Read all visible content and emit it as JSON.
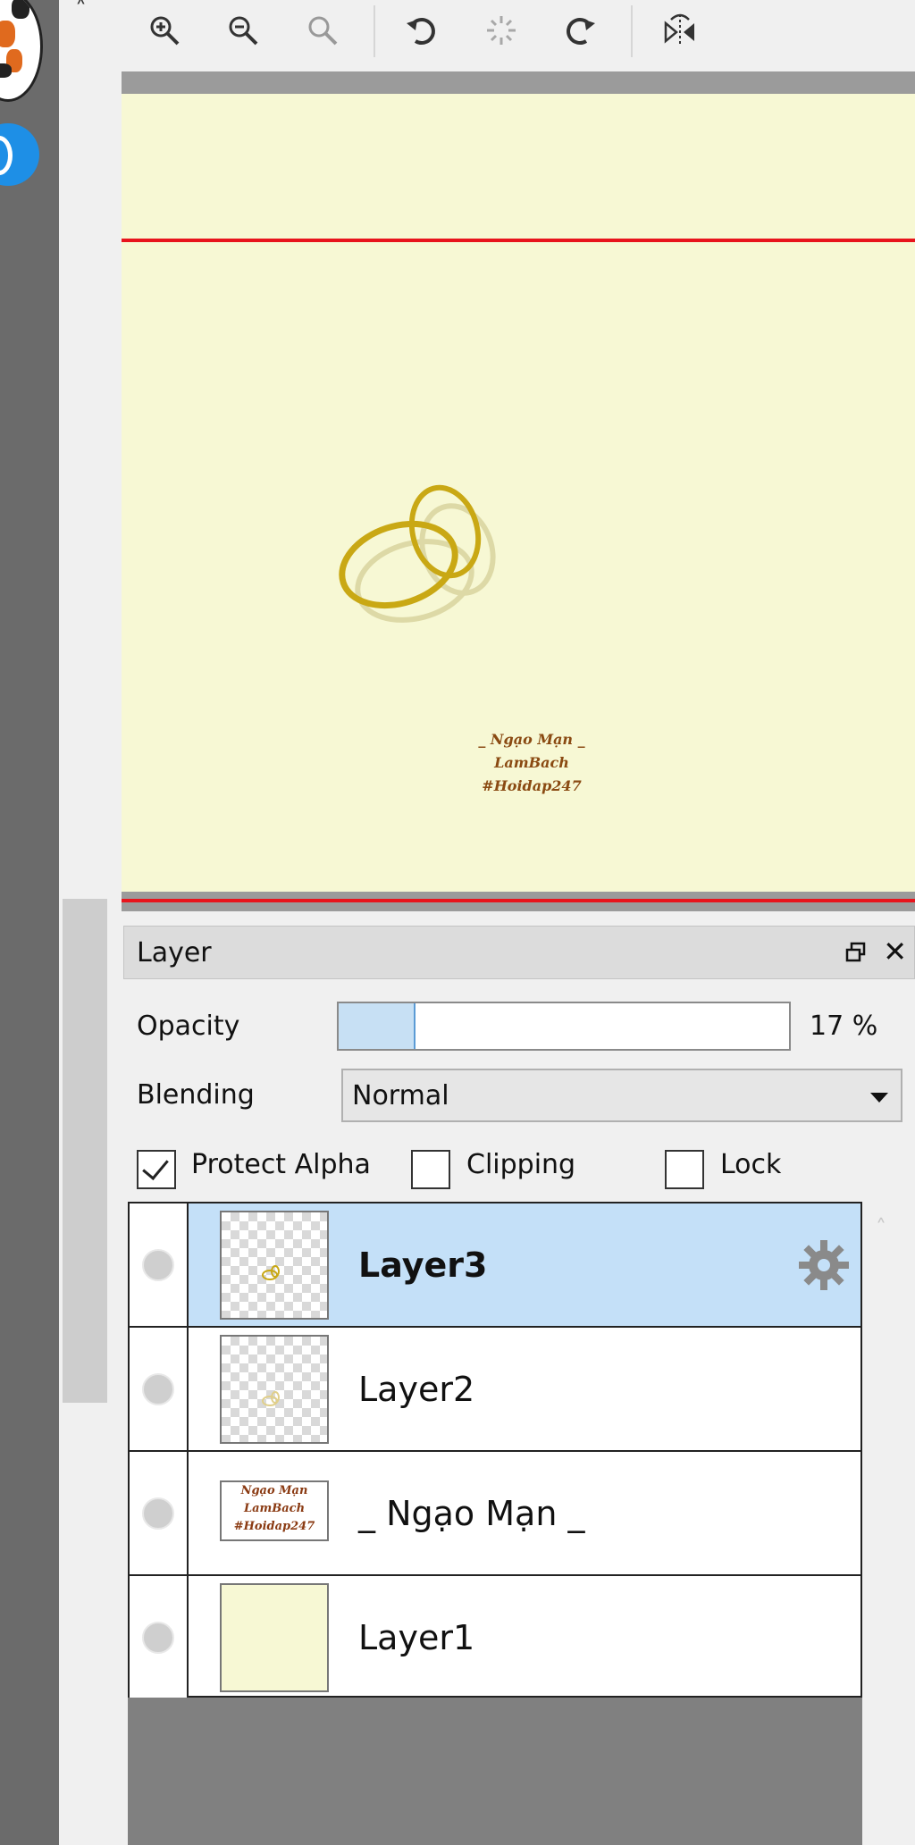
{
  "toolbar": {
    "buttons": [
      {
        "name": "zoom-in-icon",
        "glyph": "🔍︎+",
        "enabled": true
      },
      {
        "name": "zoom-out-icon",
        "glyph": "🔍︎−",
        "enabled": true
      },
      {
        "name": "zoom-reset-icon",
        "glyph": "🔍︎",
        "enabled": false
      },
      {
        "name": "rotate-left-icon",
        "glyph": "↶",
        "enabled": true
      },
      {
        "name": "rotate-reset-icon",
        "glyph": "✺",
        "enabled": false
      },
      {
        "name": "rotate-right-icon",
        "glyph": "↷",
        "enabled": true
      },
      {
        "name": "flip-horizontal-icon",
        "glyph": "⇋",
        "enabled": true
      }
    ]
  },
  "canvas": {
    "background": "#f7f8d4",
    "guide_color": "#e8141c",
    "watermark_lines": [
      "_ Ngạo Mạn _",
      "LamBach",
      "#Hoidap247"
    ]
  },
  "panel": {
    "title": "Layer",
    "opacity_label": "Opacity",
    "opacity_value": 17,
    "opacity_text": "17 %",
    "blending_label": "Blending",
    "blending_value": "Normal",
    "protect_alpha_label": "Protect Alpha",
    "protect_alpha_checked": true,
    "clipping_label": "Clipping",
    "clipping_checked": false,
    "lock_label": "Lock",
    "lock_checked": false
  },
  "layers": [
    {
      "name": "Layer3",
      "selected": true,
      "thumb": "sketch"
    },
    {
      "name": "Layer2",
      "selected": false,
      "thumb": "sketch"
    },
    {
      "name": "_ Ngạo Mạn _",
      "selected": false,
      "thumb": "text",
      "thumb_lines": [
        "Ngạo Mạn",
        "LamBach",
        "#Hoidap247"
      ]
    },
    {
      "name": "Layer1",
      "selected": false,
      "thumb": "solid"
    }
  ],
  "colors": {
    "selection": "#c4e0f8",
    "accent_blue": "#1e8fe6",
    "watermark_text": "#8a4a12",
    "ring_gold": "#c9a814"
  }
}
